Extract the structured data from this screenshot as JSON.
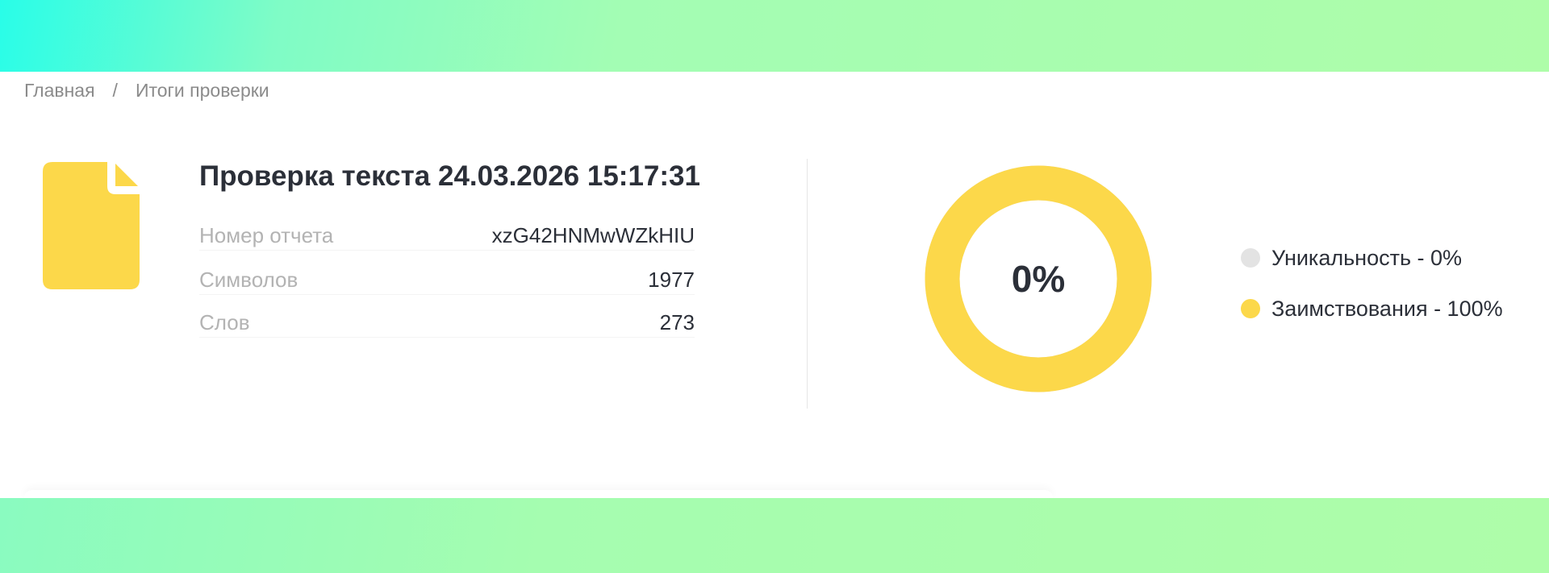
{
  "breadcrumb": {
    "home": "Главная",
    "separator": "/",
    "current": "Итоги проверки"
  },
  "report": {
    "title": "Проверка текста 24.03.2026 15:17:31",
    "icon": "document-icon",
    "rows": [
      {
        "label": "Номер отчета",
        "value": "xzG42HNMwWZkHIU"
      },
      {
        "label": "Символов",
        "value": "1977"
      },
      {
        "label": "Слов",
        "value": "273"
      }
    ]
  },
  "result": {
    "center_label": "0%",
    "uniqueness_percent": 0,
    "borrowing_percent": 100,
    "legend": [
      {
        "label": "Уникальность - 0%",
        "color": "#e3e3e3"
      },
      {
        "label": "Заимствования - 100%",
        "color": "#fcd84a"
      }
    ]
  },
  "colors": {
    "accent_yellow": "#fcd84a",
    "gradient_start": "#29fde8",
    "gradient_end": "#aefda9",
    "text_dark": "#2b2f38",
    "text_muted": "#b3b3b3"
  }
}
